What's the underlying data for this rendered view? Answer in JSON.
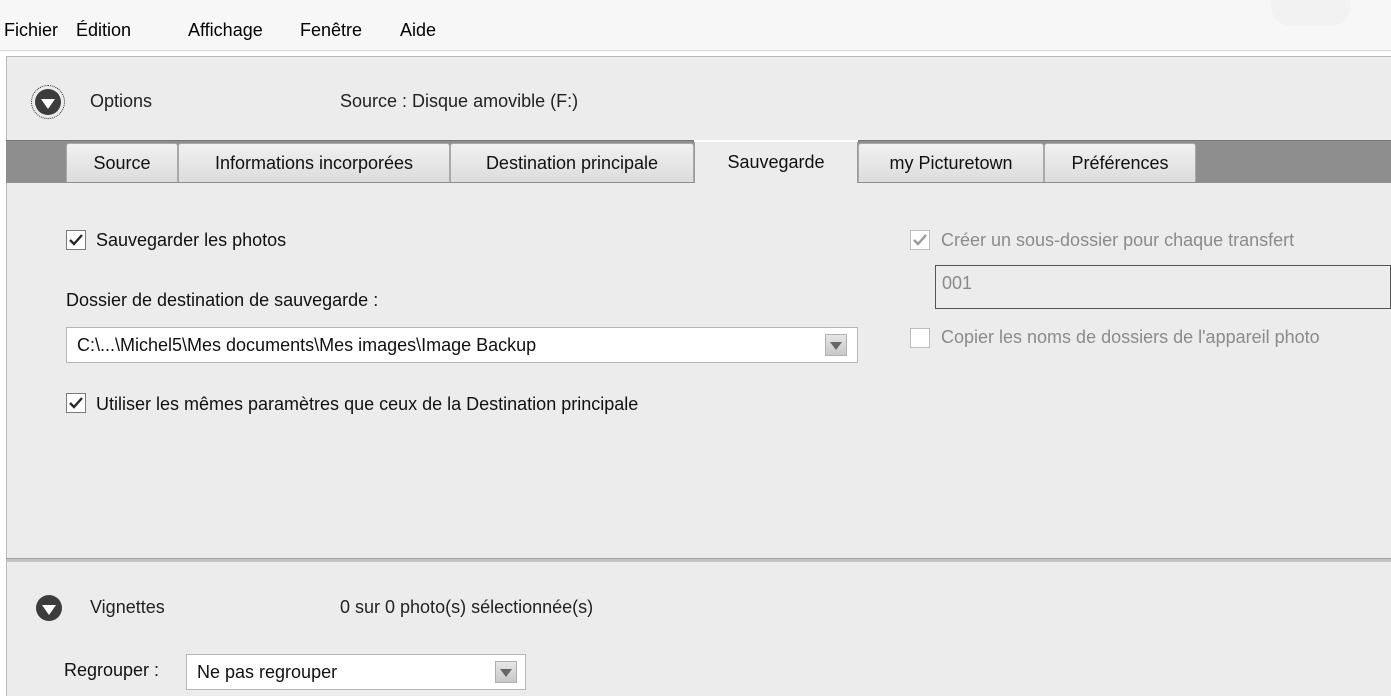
{
  "menu": [
    "Fichier",
    "Édition",
    "Affichage",
    "Fenêtre",
    "Aide"
  ],
  "options": {
    "label": "Options",
    "source_info": "Source : Disque amovible (F:)"
  },
  "tabs": [
    {
      "label": "Source",
      "active": false
    },
    {
      "label": "Informations incorporées",
      "active": false
    },
    {
      "label": "Destination principale",
      "active": false
    },
    {
      "label": "Sauvegarde",
      "active": true
    },
    {
      "label": "my Picturetown",
      "active": false
    },
    {
      "label": "Préférences",
      "active": false
    }
  ],
  "backup": {
    "save_photos_label": "Sauvegarder les photos",
    "save_photos_checked": true,
    "dest_folder_label": "Dossier de destination de sauvegarde :",
    "dest_folder_value": "C:\\...\\Michel5\\Mes documents\\Mes images\\Image Backup",
    "same_params_label": "Utiliser les mêmes paramètres que ceux de la Destination principale",
    "same_params_checked": true,
    "subfolder_label": "Créer un sous-dossier pour chaque transfert",
    "subfolder_checked": true,
    "subfolder_value": "001",
    "copy_names_label": "Copier les noms de dossiers de l'appareil photo",
    "copy_names_checked": false
  },
  "thumbnails": {
    "label": "Vignettes",
    "selection_info": "0 sur 0 photo(s) sélectionnée(s)",
    "group_label": "Regrouper :",
    "group_value": "Ne pas regrouper"
  },
  "colors": {
    "tabstrip": "#8e8e8e",
    "panel": "#ececec",
    "toggle": "#3c3c3c",
    "disabled_text": "#8b8b8b"
  }
}
